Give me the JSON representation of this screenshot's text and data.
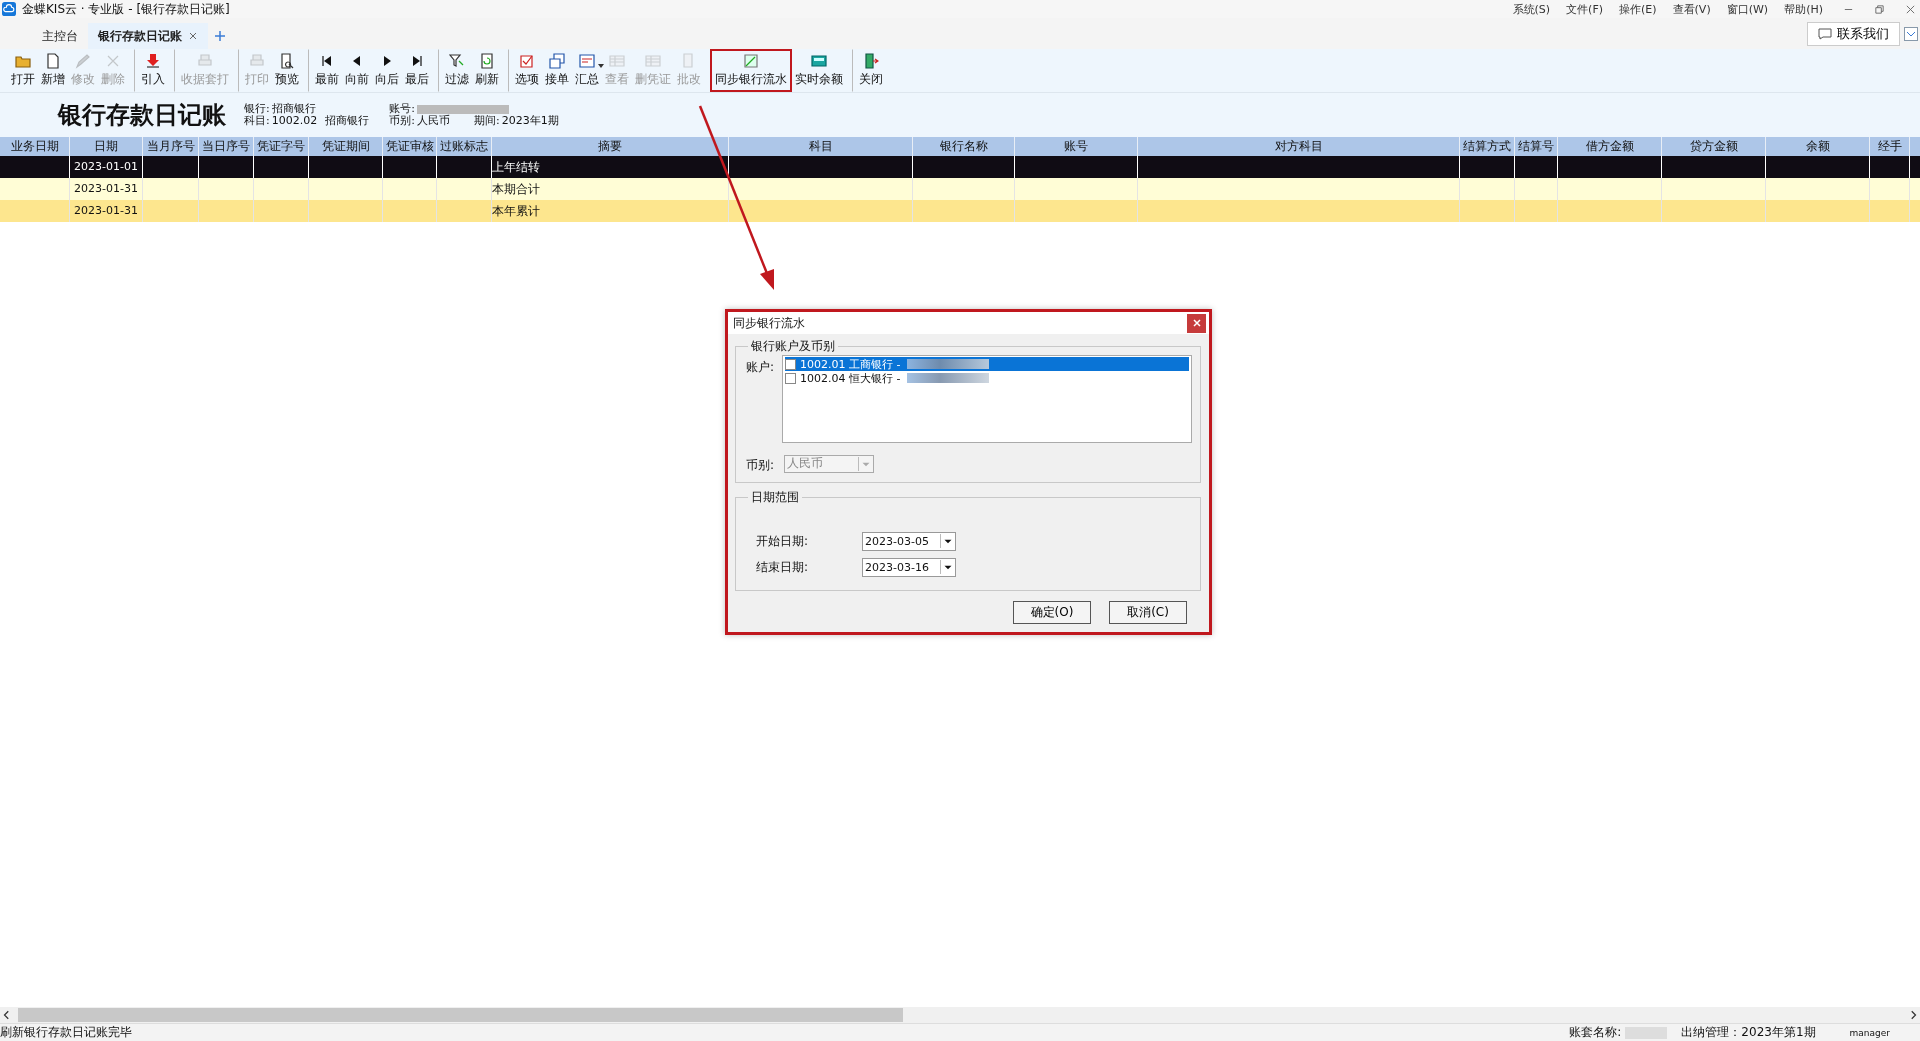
{
  "window": {
    "title": "金蝶KIS云 · 专业版 - [银行存款日记账]"
  },
  "menu": [
    "系统(S)",
    "文件(F)",
    "操作(E)",
    "查看(V)",
    "窗口(W)",
    "帮助(H)"
  ],
  "contact_button": "联系我们",
  "tabs": [
    {
      "label": "主控台",
      "selected": false,
      "closable": false
    },
    {
      "label": "银行存款日记账",
      "selected": true,
      "closable": true
    }
  ],
  "toolbar": [
    {
      "label": "打开",
      "disabled": false,
      "separator": false,
      "highlighted": false,
      "menu": false
    },
    {
      "label": "新增",
      "disabled": false,
      "separator": false,
      "highlighted": false,
      "menu": false
    },
    {
      "label": "修改",
      "disabled": true,
      "separator": false,
      "highlighted": false,
      "menu": false
    },
    {
      "label": "删除",
      "disabled": true,
      "separator": false,
      "highlighted": false,
      "menu": false
    },
    {
      "label": "引入",
      "disabled": false,
      "separator": true,
      "highlighted": false,
      "menu": false
    },
    {
      "label": "收据套打",
      "disabled": true,
      "separator": true,
      "highlighted": false,
      "menu": false
    },
    {
      "label": "打印",
      "disabled": true,
      "separator": true,
      "highlighted": false,
      "menu": false
    },
    {
      "label": "预览",
      "disabled": false,
      "separator": false,
      "highlighted": false,
      "menu": false
    },
    {
      "label": "最前",
      "disabled": false,
      "separator": true,
      "highlighted": false,
      "menu": false
    },
    {
      "label": "向前",
      "disabled": false,
      "separator": false,
      "highlighted": false,
      "menu": false
    },
    {
      "label": "向后",
      "disabled": false,
      "separator": false,
      "highlighted": false,
      "menu": false
    },
    {
      "label": "最后",
      "disabled": false,
      "separator": false,
      "highlighted": false,
      "menu": false
    },
    {
      "label": "过滤",
      "disabled": false,
      "separator": true,
      "highlighted": false,
      "menu": false
    },
    {
      "label": "刷新",
      "disabled": false,
      "separator": false,
      "highlighted": false,
      "menu": false
    },
    {
      "label": "选项",
      "disabled": false,
      "separator": true,
      "highlighted": false,
      "menu": false
    },
    {
      "label": "接单",
      "disabled": false,
      "separator": false,
      "highlighted": false,
      "menu": false
    },
    {
      "label": "汇总",
      "disabled": false,
      "separator": false,
      "highlighted": false,
      "menu": true
    },
    {
      "label": "查看",
      "disabled": true,
      "separator": false,
      "highlighted": false,
      "menu": false
    },
    {
      "label": "删凭证",
      "disabled": true,
      "separator": false,
      "highlighted": false,
      "menu": false
    },
    {
      "label": "批改",
      "disabled": true,
      "separator": false,
      "highlighted": false,
      "menu": false
    },
    {
      "label": "同步银行流水",
      "disabled": false,
      "separator": true,
      "highlighted": true,
      "menu": false
    },
    {
      "label": "实时余额",
      "disabled": false,
      "separator": false,
      "highlighted": false,
      "menu": false
    },
    {
      "label": "关闭",
      "disabled": false,
      "separator": true,
      "highlighted": false,
      "menu": false
    }
  ],
  "ledger": {
    "title": "银行存款日记账",
    "fields": [
      {
        "label": "银行:",
        "value": "招商银行"
      },
      {
        "label": "科目:",
        "value": "1002.02"
      },
      {
        "label": "招商银行"
      }
    ],
    "fields2": [
      {
        "label": "账号:"
      },
      {
        "label": "币别:",
        "value": "人民币"
      }
    ],
    "period": {
      "label": "期间:",
      "value": "2023年1期"
    }
  },
  "table": {
    "columns": [
      {
        "label": "业务日期",
        "kind": "other"
      },
      {
        "label": "日期",
        "kind": "date"
      },
      {
        "label": "当月序号",
        "kind": "other"
      },
      {
        "label": "当日序号",
        "kind": "other"
      },
      {
        "label": "凭证字号",
        "kind": "other"
      },
      {
        "label": "凭证期间",
        "kind": "other"
      },
      {
        "label": "凭证审核",
        "kind": "other"
      },
      {
        "label": "过账标志",
        "kind": "other"
      },
      {
        "label": "摘要",
        "kind": "summary"
      },
      {
        "label": "科目",
        "kind": "other"
      },
      {
        "label": "银行名称",
        "kind": "other"
      },
      {
        "label": "账号",
        "kind": "other"
      },
      {
        "label": "对方科目",
        "kind": "other"
      },
      {
        "label": "结算方式",
        "kind": "other"
      },
      {
        "label": "结算号",
        "kind": "other"
      },
      {
        "label": "借方金额",
        "kind": "other"
      },
      {
        "label": "贷方金额",
        "kind": "other"
      },
      {
        "label": "余额",
        "kind": "other"
      },
      {
        "label": "经手",
        "kind": "other"
      }
    ],
    "rows": [
      {
        "date": "2023-01-01",
        "summary": "上年结转",
        "selected": true,
        "kind": "carry"
      },
      {
        "date": "2023-01-31",
        "summary": "本期合计",
        "selected": false,
        "kind": "period"
      },
      {
        "date": "2023-01-31",
        "summary": "本年累计",
        "selected": false,
        "kind": "year"
      }
    ]
  },
  "dialog": {
    "title": "同步银行流水",
    "highlighted": true,
    "account_group": "银行账户及币别",
    "account_label": "账户:",
    "accounts": [
      {
        "label": "1002.01 工商银行 -",
        "checked": false,
        "selected": true
      },
      {
        "label": "1002.04 恒大银行 -",
        "checked": false,
        "selected": false
      }
    ],
    "currency_label": "币别:",
    "currency": {
      "value": "人民币",
      "disabled": true
    },
    "date_group": "日期范围",
    "dates": [
      {
        "label": "开始日期:",
        "value": "2023-03-05"
      },
      {
        "label": "结束日期:",
        "value": "2023-03-16"
      }
    ],
    "buttons": [
      "确定(O)",
      "取消(C)"
    ]
  },
  "status_bar": {
    "message": "刷新银行存款日记账完毕",
    "book_label": "账套名称:",
    "period": "出纳管理：2023年第1期",
    "user": "manager"
  }
}
